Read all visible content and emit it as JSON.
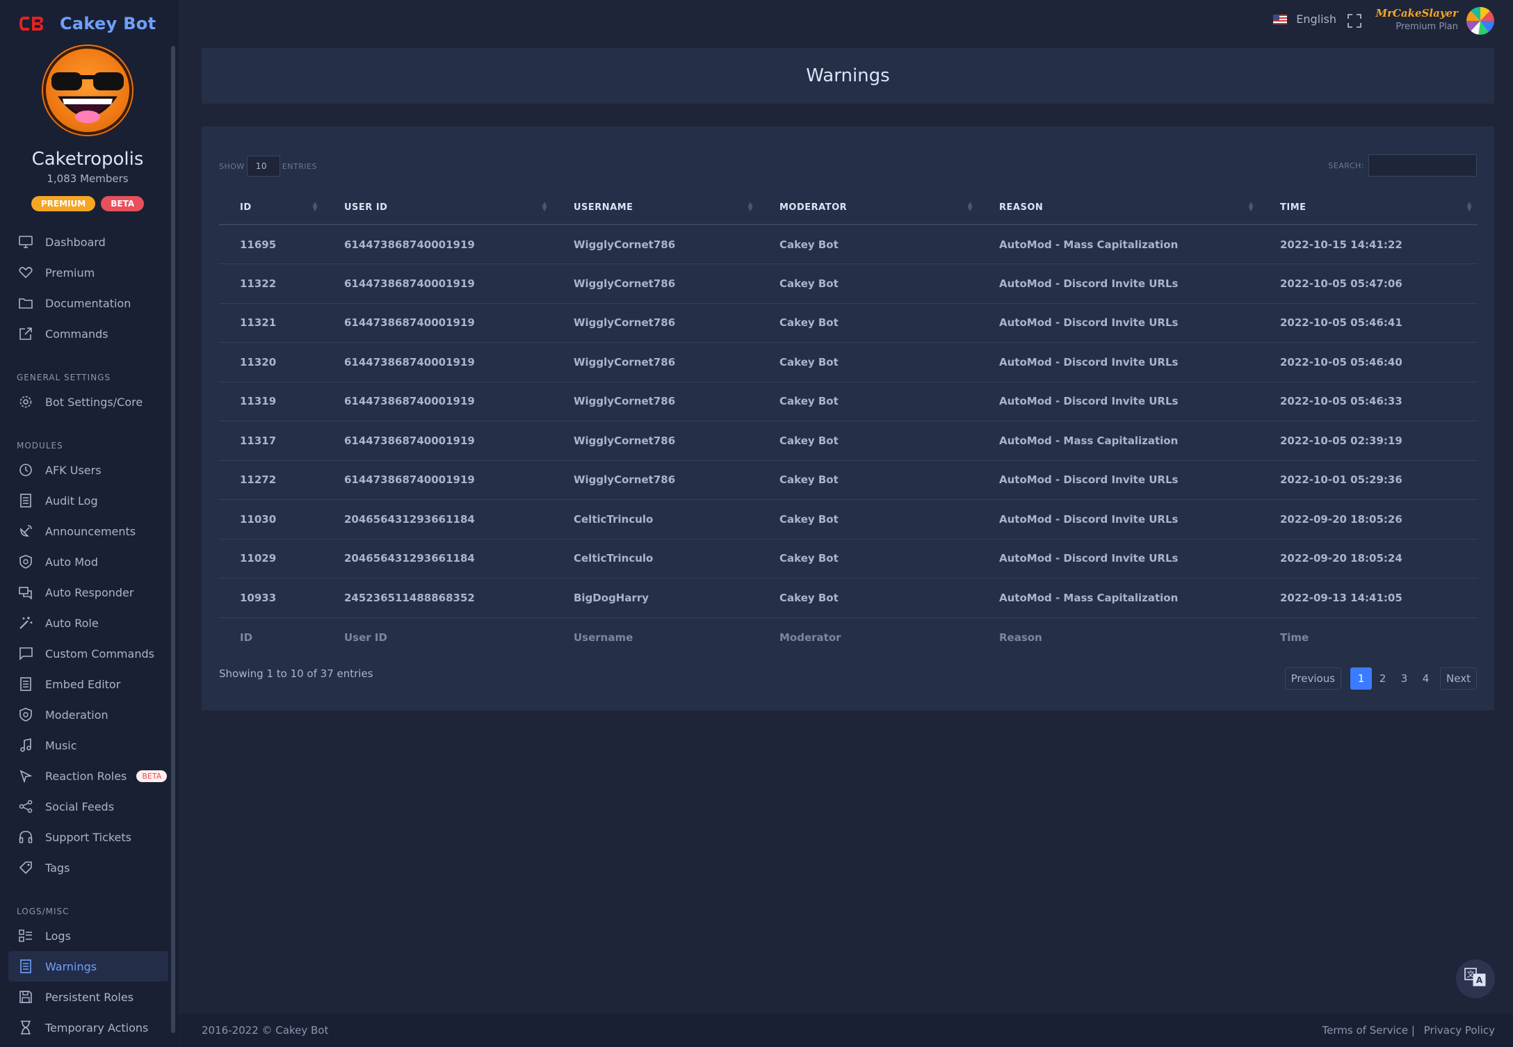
{
  "brand": {
    "name": "Cakey Bot"
  },
  "server": {
    "name": "Caketropolis",
    "members": "1,083 Members",
    "badge_premium": "PREMIUM",
    "badge_beta": "BETA"
  },
  "nav": {
    "dashboard": "Dashboard",
    "premium": "Premium",
    "documentation": "Documentation",
    "commands": "Commands",
    "general_settings": "GENERAL SETTINGS",
    "bot_settings": "Bot Settings/Core",
    "modules": "MODULES",
    "afk_users": "AFK Users",
    "audit_log": "Audit Log",
    "announcements": "Announcements",
    "auto_mod": "Auto Mod",
    "auto_responder": "Auto Responder",
    "auto_role": "Auto Role",
    "custom_commands": "Custom Commands",
    "embed_editor": "Embed Editor",
    "moderation": "Moderation",
    "music": "Music",
    "reaction_roles": "Reaction Roles",
    "reaction_roles_badge": "BETA",
    "social_feeds": "Social Feeds",
    "support_tickets": "Support Tickets",
    "tags": "Tags",
    "logs_misc": "LOGS/MISC",
    "logs": "Logs",
    "warnings": "Warnings",
    "persistent_roles": "Persistent Roles",
    "temporary_actions": "Temporary Actions"
  },
  "topbar": {
    "language": "English",
    "user_name": "MrCakeSlayer",
    "user_plan": "Premium Plan"
  },
  "page": {
    "title": "Warnings"
  },
  "table": {
    "show_label": "SHOW",
    "page_length": "10",
    "entries_label": "ENTRIES",
    "search_label": "SEARCH:",
    "headers": [
      "ID",
      "USER ID",
      "USERNAME",
      "MODERATOR",
      "REASON",
      "TIME"
    ],
    "footers": [
      "ID",
      "User ID",
      "Username",
      "Moderator",
      "Reason",
      "Time"
    ],
    "rows": [
      [
        "11695",
        "614473868740001919",
        "WigglyCornet786",
        "Cakey Bot",
        "AutoMod - Mass Capitalization",
        "2022-10-15 14:41:22"
      ],
      [
        "11322",
        "614473868740001919",
        "WigglyCornet786",
        "Cakey Bot",
        "AutoMod - Discord Invite URLs",
        "2022-10-05 05:47:06"
      ],
      [
        "11321",
        "614473868740001919",
        "WigglyCornet786",
        "Cakey Bot",
        "AutoMod - Discord Invite URLs",
        "2022-10-05 05:46:41"
      ],
      [
        "11320",
        "614473868740001919",
        "WigglyCornet786",
        "Cakey Bot",
        "AutoMod - Discord Invite URLs",
        "2022-10-05 05:46:40"
      ],
      [
        "11319",
        "614473868740001919",
        "WigglyCornet786",
        "Cakey Bot",
        "AutoMod - Discord Invite URLs",
        "2022-10-05 05:46:33"
      ],
      [
        "11317",
        "614473868740001919",
        "WigglyCornet786",
        "Cakey Bot",
        "AutoMod - Mass Capitalization",
        "2022-10-05 02:39:19"
      ],
      [
        "11272",
        "614473868740001919",
        "WigglyCornet786",
        "Cakey Bot",
        "AutoMod - Discord Invite URLs",
        "2022-10-01 05:29:36"
      ],
      [
        "11030",
        "204656431293661184",
        "CelticTrinculo",
        "Cakey Bot",
        "AutoMod - Discord Invite URLs",
        "2022-09-20 18:05:26"
      ],
      [
        "11029",
        "204656431293661184",
        "CelticTrinculo",
        "Cakey Bot",
        "AutoMod - Discord Invite URLs",
        "2022-09-20 18:05:24"
      ],
      [
        "10933",
        "245236511488868352",
        "BigDogHarry",
        "Cakey Bot",
        "AutoMod - Mass Capitalization",
        "2022-09-13 14:41:05"
      ]
    ],
    "info": "Showing 1 to 10 of 37 entries",
    "pagination": {
      "previous": "Previous",
      "pages": [
        "1",
        "2",
        "3",
        "4"
      ],
      "next": "Next"
    }
  },
  "footer": {
    "copyright": "2016-2022 © Cakey Bot",
    "terms": "Terms of Service |",
    "privacy": "Privacy Policy"
  },
  "colors": {
    "accent": "#6ea0ff",
    "premium": "#f5a623",
    "beta": "#e8505b",
    "bg": "#1e2538",
    "card": "#262f48"
  }
}
